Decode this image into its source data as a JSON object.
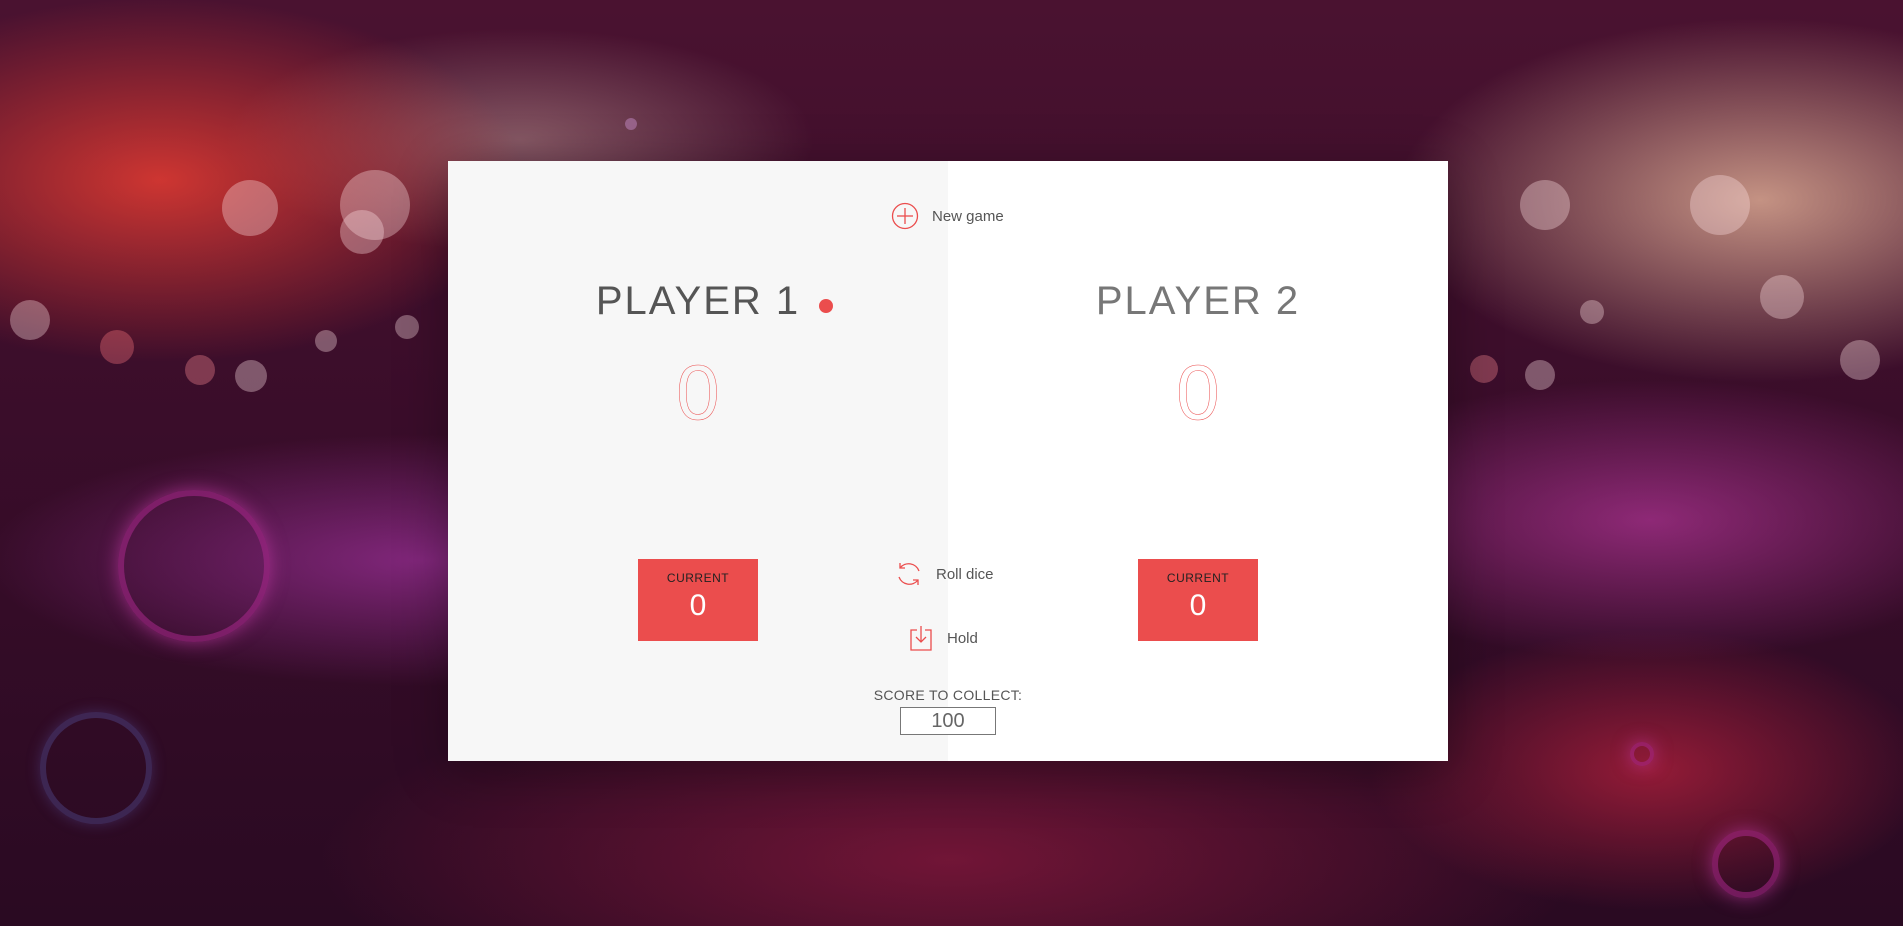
{
  "controls": {
    "new_game": "New game",
    "roll_dice": "Roll dice",
    "hold": "Hold",
    "icons": {
      "new_game": "plus-circle-icon",
      "roll_dice": "refresh-icon",
      "hold": "download-icon"
    }
  },
  "players": [
    {
      "name": "PLAYER 1",
      "score": "0",
      "current_label": "CURRENT",
      "current_score": "0",
      "active": true
    },
    {
      "name": "PLAYER 2",
      "score": "0",
      "current_label": "CURRENT",
      "current_score": "0",
      "active": false
    }
  ],
  "score_to_collect": {
    "label": "SCORE TO COLLECT:",
    "value": "100"
  },
  "colors": {
    "accent": "#EB4D4D",
    "active_panel": "#F7F7F7",
    "inactive_panel": "#FFFFFF"
  }
}
